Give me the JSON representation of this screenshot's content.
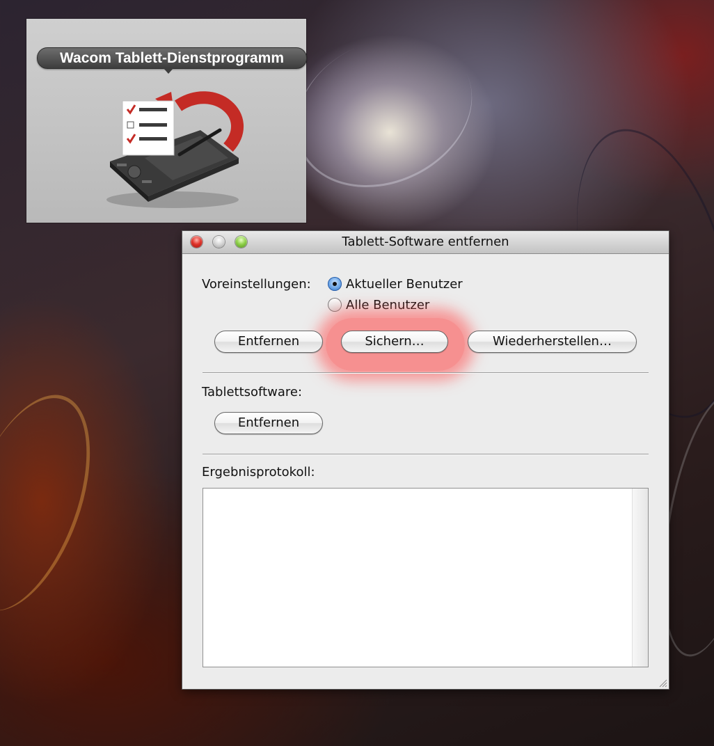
{
  "app_tile": {
    "title": "Wacom Tablett-Dienstprogramm",
    "icon": "tablet-checklist-restore-icon"
  },
  "dialog": {
    "title": "Tablett-Software entfernen",
    "traffic_lights": [
      "close-button",
      "minimize-button",
      "zoom-button"
    ],
    "preferences": {
      "label": "Voreinstellungen:",
      "options": [
        {
          "label": "Aktueller Benutzer",
          "selected": true
        },
        {
          "label": "Alle Benutzer",
          "selected": false
        }
      ],
      "buttons": {
        "remove": "Entfernen",
        "backup": "Sichern…",
        "restore": "Wiederherstellen…"
      }
    },
    "tablet_software": {
      "label": "Tablettsoftware:",
      "remove": "Entfernen"
    },
    "result_log": {
      "label": "Ergebnisprotokoll:",
      "value": ""
    },
    "highlight_color": "#ff4a4a"
  }
}
